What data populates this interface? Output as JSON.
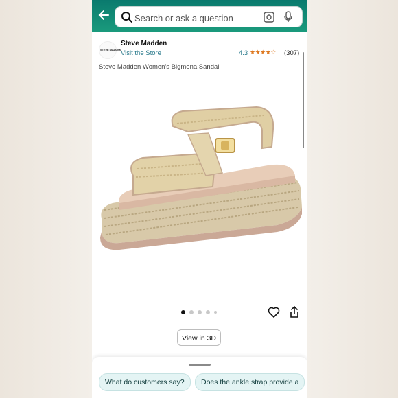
{
  "search": {
    "placeholder": "Search or ask a question"
  },
  "seller": {
    "name": "Steve Madden",
    "logo_text": "STEVE MADDEN",
    "link": "Visit the Store"
  },
  "rating": {
    "value": "4.3",
    "stars": "★★★★☆",
    "count": "(307)"
  },
  "product": {
    "title": "Steve Madden Women's Bigmona Sandal"
  },
  "carousel": {
    "total_images": 5,
    "active_index": 0
  },
  "buttons": {
    "view_3d": "View in 3D"
  },
  "suggestions": [
    {
      "label": "What do customers say?"
    },
    {
      "label": "Does the ankle strap provide a"
    }
  ],
  "colors": {
    "header": "#0f8a74",
    "link": "#2a7a8c",
    "star": "#de7921",
    "chip_bg": "#e4f4f4"
  },
  "icons": [
    "back-arrow-icon",
    "search-icon",
    "camera-icon",
    "microphone-icon",
    "heart-icon",
    "share-icon"
  ]
}
